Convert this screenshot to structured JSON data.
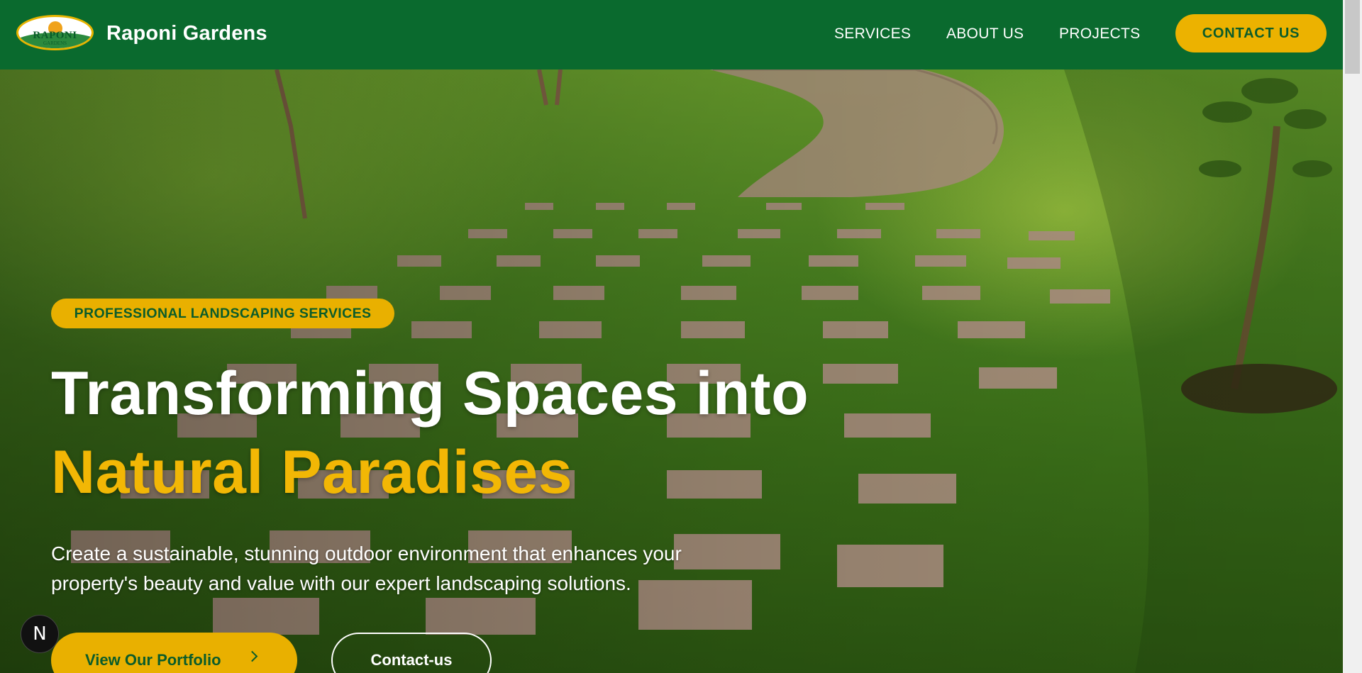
{
  "header": {
    "brand_name": "Raponi Gardens",
    "logo_text": "RAPONI",
    "logo_subtext": "GARDENS",
    "nav": [
      {
        "label": "SERVICES"
      },
      {
        "label": "ABOUT US"
      },
      {
        "label": "PROJECTS"
      }
    ],
    "contact_label": "CONTACT US"
  },
  "hero": {
    "badge": "PROFESSIONAL LANDSCAPING SERVICES",
    "title_line1": "Transforming Spaces into",
    "title_line2": "Natural Paradises",
    "description": "Create a sustainable, stunning outdoor environment that enhances your property's beauty and value with our expert landscaping solutions.",
    "primary_cta": "View Our Portfolio",
    "secondary_cta": "Contact-us"
  },
  "dev_badge": {
    "glyph": "N"
  },
  "colors": {
    "header_green": "#0a6a2e",
    "accent_yellow": "#e9b000",
    "dark_green_text": "#0b5c2a"
  }
}
